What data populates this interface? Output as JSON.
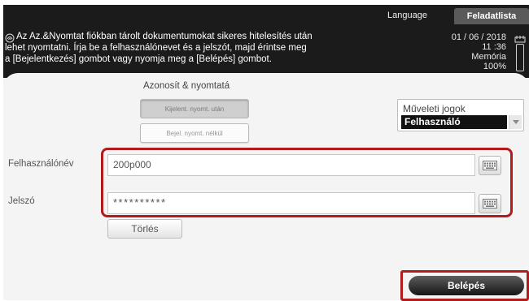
{
  "header": {
    "language_tab": "Language",
    "task_list_tab": "Feladatlista",
    "message_lines": [
      "Az Az.&Nyomtat fiókban tárolt dokumentumokat sikeres hitelesítés után",
      "lehet nyomtatni. Írja be a felhasználónevet és a jelszót, majd érintse meg",
      "a [Bejelentkezés] gombot vagy nyomja meg a [Belépés] gombot."
    ],
    "date": "01 / 06 / 2018",
    "time": "11 :36",
    "memory_label": "Memória",
    "memory_value": "100%"
  },
  "auth": {
    "title": "Azonosít & nyomtatá",
    "option_selected": "Kijelent. nyomt. után",
    "option_other": "Bejel. nyomt. nélkül"
  },
  "rights": {
    "label": "Műveleti jogok",
    "value": "Felhasználó"
  },
  "form": {
    "username_label": "Felhasználónév",
    "username_value": "200p000",
    "password_label": "Jelszó",
    "password_value": "**********",
    "clear_label": "Törlés"
  },
  "login": {
    "label": "Belépés"
  },
  "icons": {
    "message": "fingerprint-icon",
    "tray": "paper-tray-icon",
    "keyboard": "keyboard-icon",
    "dropdown": "chevron-down-icon"
  }
}
